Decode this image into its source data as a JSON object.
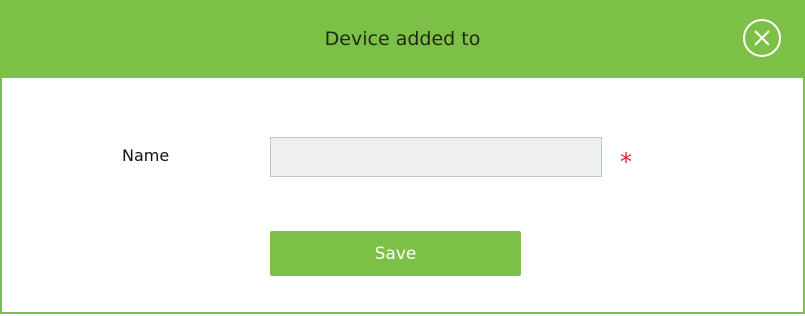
{
  "dialog": {
    "title": "Device added to",
    "close_icon": "close-circle-icon",
    "accent_color": "#7cc048",
    "required_color": "#e0232b"
  },
  "form": {
    "name_label": "Name",
    "name_value": "",
    "required_mark": "*",
    "save_label": "Save"
  }
}
